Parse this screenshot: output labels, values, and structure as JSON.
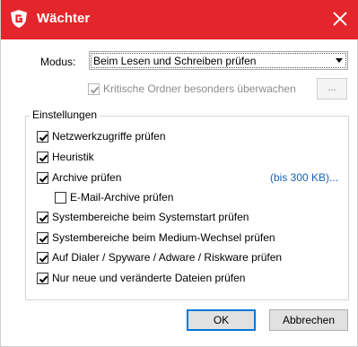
{
  "titlebar": {
    "title": "Wächter",
    "bg_color": "#e3262c",
    "logo_icon": "gdata-shield-logo",
    "close_icon": "close-x"
  },
  "modus": {
    "label": "Modus:",
    "selected": "Beim Lesen und Schreiben prüfen"
  },
  "critical_folders": {
    "label": "Kritische Ordner besonders überwachen",
    "checked": true,
    "disabled": true,
    "button_label": "..."
  },
  "settings": {
    "group_label": "Einstellungen",
    "items": [
      {
        "label": "Netzwerkzugriffe prüfen",
        "checked": true
      },
      {
        "label": "Heuristik",
        "checked": true
      },
      {
        "label": "Archive prüfen",
        "checked": true
      },
      {
        "label": "E-Mail-Archive prüfen",
        "checked": false
      },
      {
        "label": "Systembereiche beim Systemstart prüfen",
        "checked": true
      },
      {
        "label": "Systembereiche beim Medium-Wechsel prüfen",
        "checked": true
      },
      {
        "label": "Auf Dialer / Spyware / Adware / Riskware prüfen",
        "checked": true
      },
      {
        "label": "Nur neue und veränderte Dateien prüfen",
        "checked": true
      }
    ],
    "archive_limit_link": "(bis 300 KB)..."
  },
  "buttons": {
    "ok": "OK",
    "cancel": "Abbrechen"
  }
}
